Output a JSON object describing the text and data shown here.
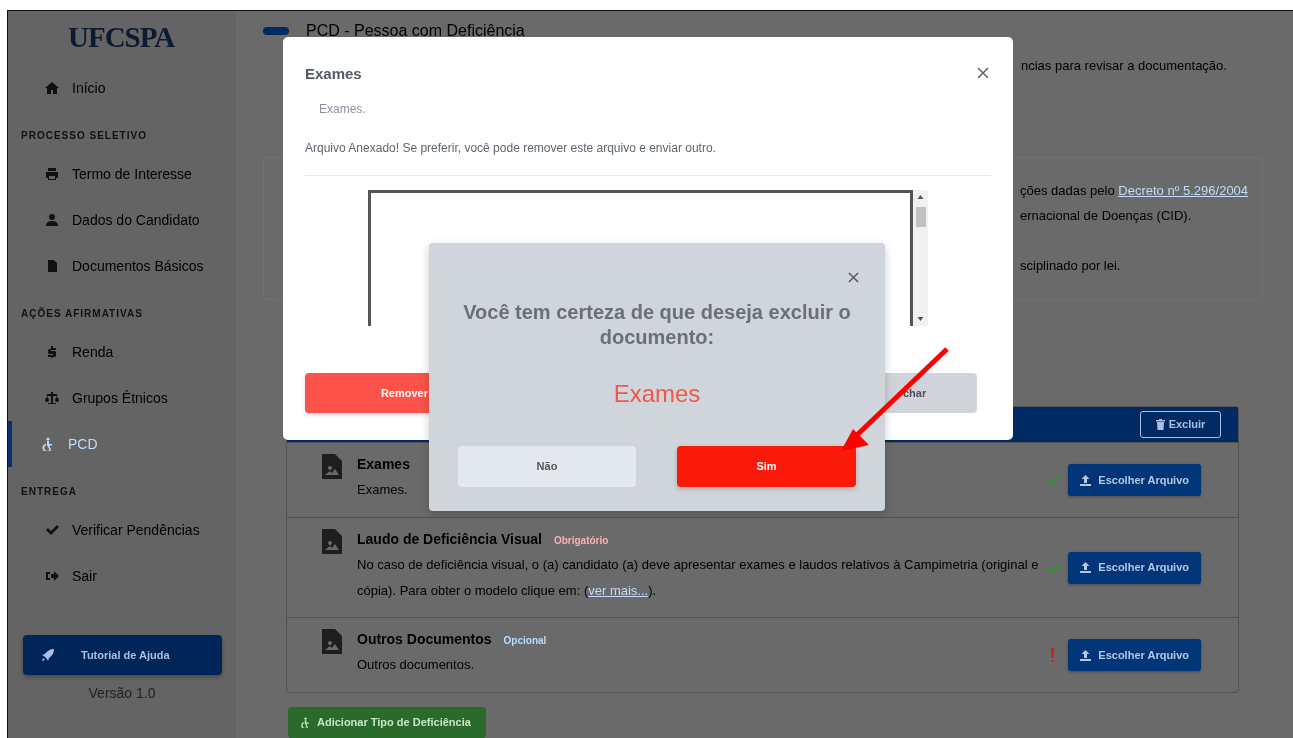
{
  "sidebar": {
    "logo": "UFCSPA",
    "items": [
      {
        "kind": "link",
        "label": "Início",
        "selected": false
      },
      {
        "kind": "section",
        "label": "PROCESSO SELETIVO"
      },
      {
        "kind": "link",
        "label": "Termo de Interesse",
        "selected": false
      },
      {
        "kind": "link",
        "label": "Dados do Candidato",
        "selected": false
      },
      {
        "kind": "link",
        "label": "Documentos Básicos",
        "selected": false
      },
      {
        "kind": "section",
        "label": "AÇÕES AFIRMATIVAS"
      },
      {
        "kind": "link",
        "label": "Renda",
        "selected": false
      },
      {
        "kind": "link",
        "label": "Grupos Étnicos",
        "selected": false
      },
      {
        "kind": "link",
        "label": "PCD",
        "selected": true
      },
      {
        "kind": "section",
        "label": "ENTREGA"
      },
      {
        "kind": "link",
        "label": "Verificar Pendências",
        "selected": false
      },
      {
        "kind": "link",
        "label": "Sair",
        "selected": false
      }
    ],
    "help_button": "Tutorial de Ajuda",
    "version": "Versão 1.0"
  },
  "page": {
    "title": "PCD - Pessoa com Deficiência",
    "intro": "ncias para revisar a documentação.",
    "info_lines": [
      {
        "text": "ções dadas pelo ",
        "link": "Decreto nº 5.296/2004"
      },
      {
        "text": "ernacional de Doenças (CID)."
      },
      {
        "text": "sciplinado por lei."
      }
    ],
    "delete_button": "Excluir",
    "documents": [
      {
        "title": "Exames",
        "description": "Exames.",
        "attached": true,
        "button": "Escolher Arquivo"
      },
      {
        "title": "Laudo de Deficiência Visual",
        "tag": {
          "label": "Obrigatório",
          "kind": "required"
        },
        "description": "No caso de deficiência visual, o (a) candidato (a) deve apresentar exames e laudos relativos à Campimetria (original e cópia). Para obter o modelo clique em: (",
        "link": "ver mais...",
        "after_link": ").",
        "attached": true,
        "button": "Escolher Arquivo"
      },
      {
        "title": "Outros Documentos",
        "tag": {
          "label": "Opcional",
          "kind": "optional"
        },
        "description": "Outros documentos.",
        "attached": false,
        "button": "Escolher Arquivo"
      }
    ],
    "add_button": "Adicionar Tipo de Deficiência"
  },
  "file_modal": {
    "title": "Exames",
    "subtitle": "Exames.",
    "message": "Arquivo Anexado! Se preferir, você pode remover este arquivo e enviar outro.",
    "buttons": [
      {
        "label": "Remover",
        "kind": "danger"
      },
      {
        "label": "char",
        "kind": "secondary"
      }
    ]
  },
  "confirm_modal": {
    "title": "Você tem certeza de que deseja excluir o documento:",
    "document": "Exames",
    "buttons": [
      {
        "label": "Não",
        "kind": "cancel"
      },
      {
        "label": "Sim",
        "kind": "confirm"
      }
    ]
  },
  "annotation_arrow": true
}
